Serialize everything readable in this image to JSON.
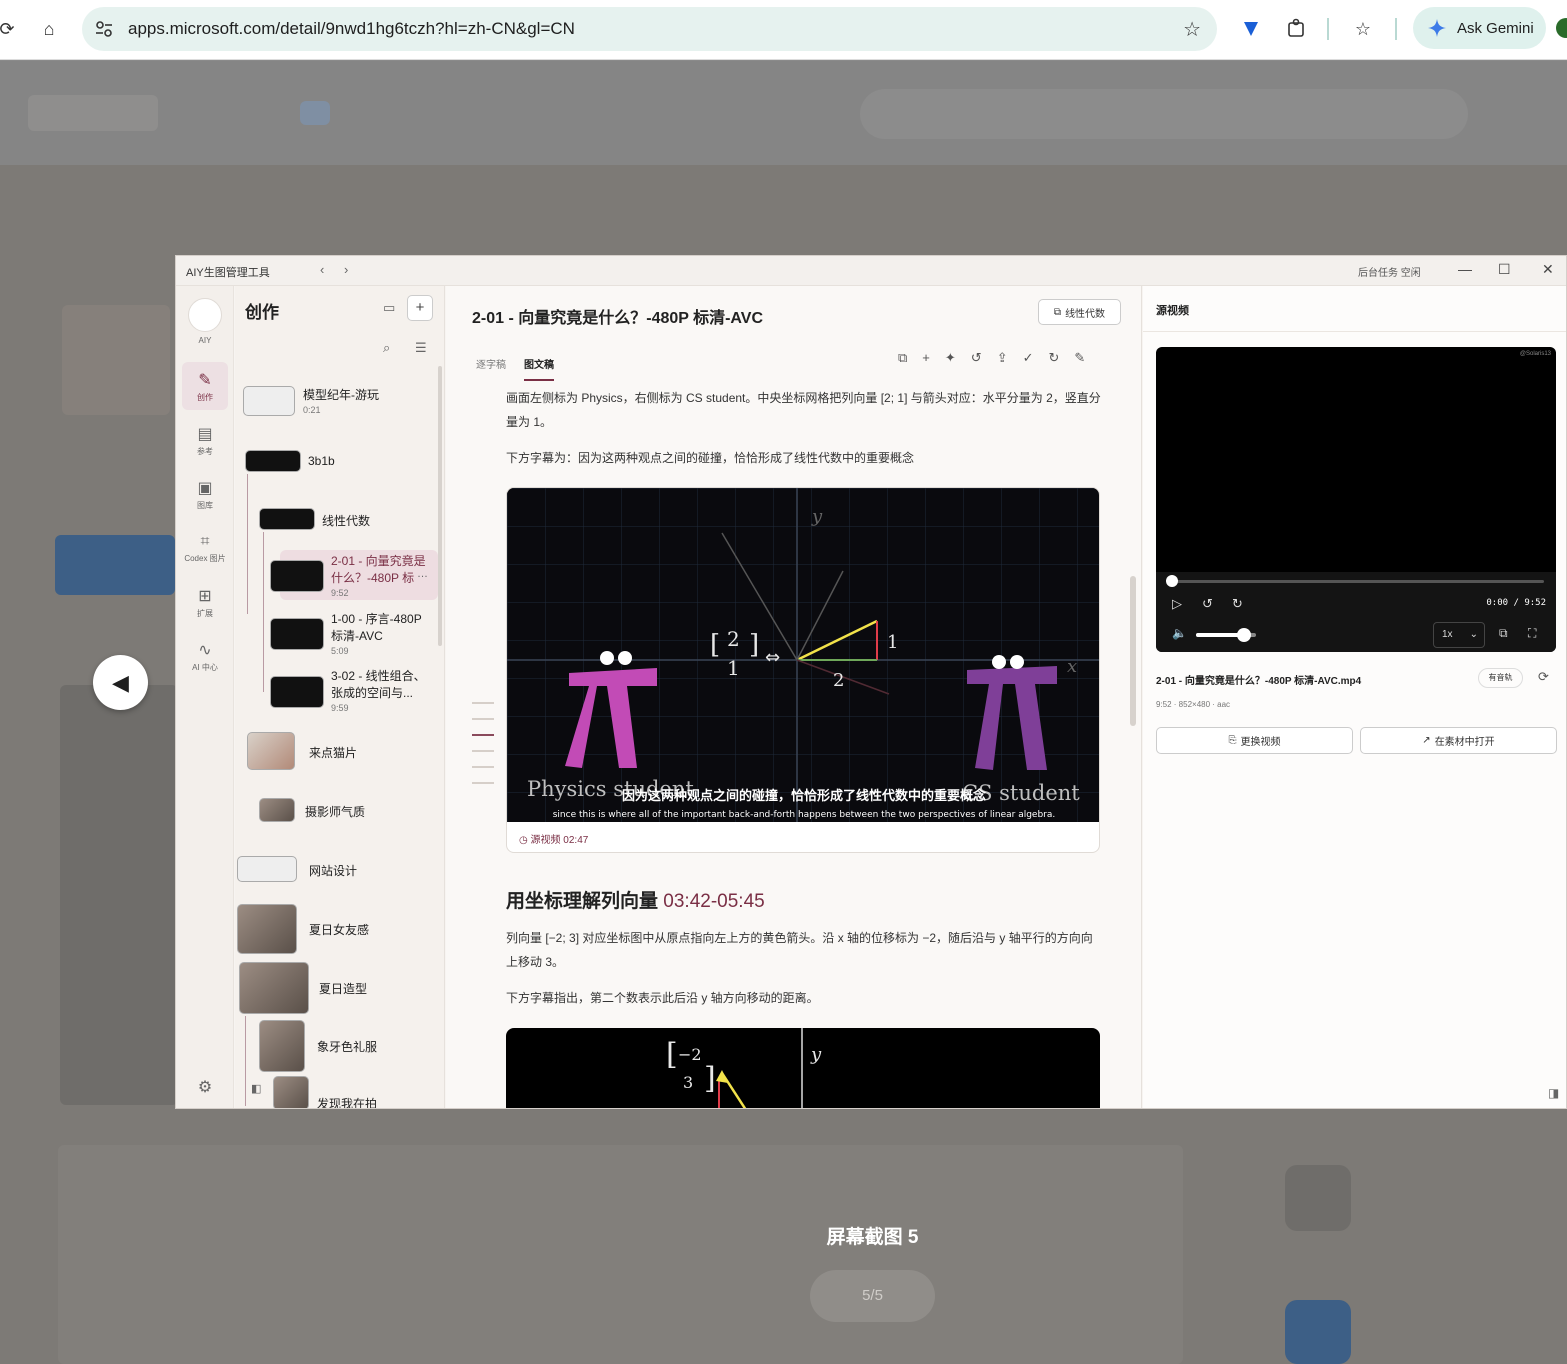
{
  "browser": {
    "url": "apps.microsoft.com/detail/9nwd1hg6tczh?hl=zh-CN&gl=CN",
    "gemini_label": "Ask Gemini"
  },
  "store": {
    "screenshot_caption": "屏幕截图 5",
    "pager": "5/5"
  },
  "app": {
    "title": "AIY生图管理工具",
    "status": "后台任务 空闲",
    "rail": {
      "logo_label": "AIY",
      "items": [
        {
          "label": "创作",
          "icon": "edit-icon"
        },
        {
          "label": "参考",
          "icon": "book-icon"
        },
        {
          "label": "图库",
          "icon": "gallery-icon"
        },
        {
          "label": "Codex 图片",
          "icon": "scan-icon"
        },
        {
          "label": "扩展",
          "icon": "extension-icon"
        },
        {
          "label": "AI 中心",
          "icon": "pulse-icon"
        }
      ]
    },
    "tree": {
      "header": "创作",
      "nodes": [
        {
          "label": "模型纪年-游玩",
          "sub": "0:21"
        },
        {
          "label": "3b1b"
        },
        {
          "label": "线性代数"
        },
        {
          "label": "2-01 - 向量究竟是什么？-480P 标",
          "label2": "什么？-480P 标",
          "sub": "9:52"
        },
        {
          "label": "1-00 - 序言-480P",
          "label2": "标清-AVC",
          "sub": "5:09"
        },
        {
          "label": "3-02 - 线性组合、",
          "label2": "张成的空间与...",
          "sub": "9:59"
        },
        {
          "label": "来点猫片"
        },
        {
          "label": "摄影师气质"
        },
        {
          "label": "网站设计"
        },
        {
          "label": "夏日女友感"
        },
        {
          "label": "夏日造型"
        },
        {
          "label": "象牙色礼服"
        },
        {
          "label": "发现我在拍"
        }
      ],
      "active_label_line1": "2-01 - 向量究竟是",
      "active_label_line2": "什么？-480P 标"
    },
    "doc": {
      "title": "2-01 - 向量究竟是什么？-480P 标清-AVC",
      "tag": "线性代数",
      "tabs": [
        "逐字稿",
        "图文稿"
      ],
      "para1": "画面左侧标为 Physics，右侧标为 CS student。中央坐标网格把列向量 [2; 1] 与箭头对应：水平分量为 2，竖直分量为 1。",
      "para2": "下方字幕为：因为这两种观点之间的碰撞，恰恰形成了线性代数中的重要概念",
      "video_subtitle_cn": "因为这两种观点之间的碰撞，恰恰形成了线性代数中的重要概念",
      "video_subtitle_en": "since this is where all of the important back-and-forth happens between the two perspectives of linear algebra.",
      "video_left": "Physics student",
      "video_right": "CS student",
      "video_source": "源视频 02:47",
      "section_title": "用坐标理解列向量",
      "section_time": "03:42-05:45",
      "para3": "列向量 [−2; 3] 对应坐标图中从原点指向左上方的黄色箭头。沿 x 轴的位移标为 −2，随后沿与 y 轴平行的方向向上移动 3。",
      "para4": "下方字幕指出，第二个数表示此后沿 y 轴方向移动的距离。"
    },
    "source": {
      "header": "源视频",
      "watermark": "@Solaris13",
      "timecode": "0:00 / 9:52",
      "progress": 0.0,
      "volume": 0.8,
      "speed": "1x",
      "file_name": "2-01 - 向量究竟是什么？-480P 标清-AVC.mp4",
      "file_meta": "9:52 · 852×480 · aac",
      "audio_badge": "有音轨",
      "replace_btn": "更换视频",
      "open_btn": "在素材中打开"
    }
  }
}
